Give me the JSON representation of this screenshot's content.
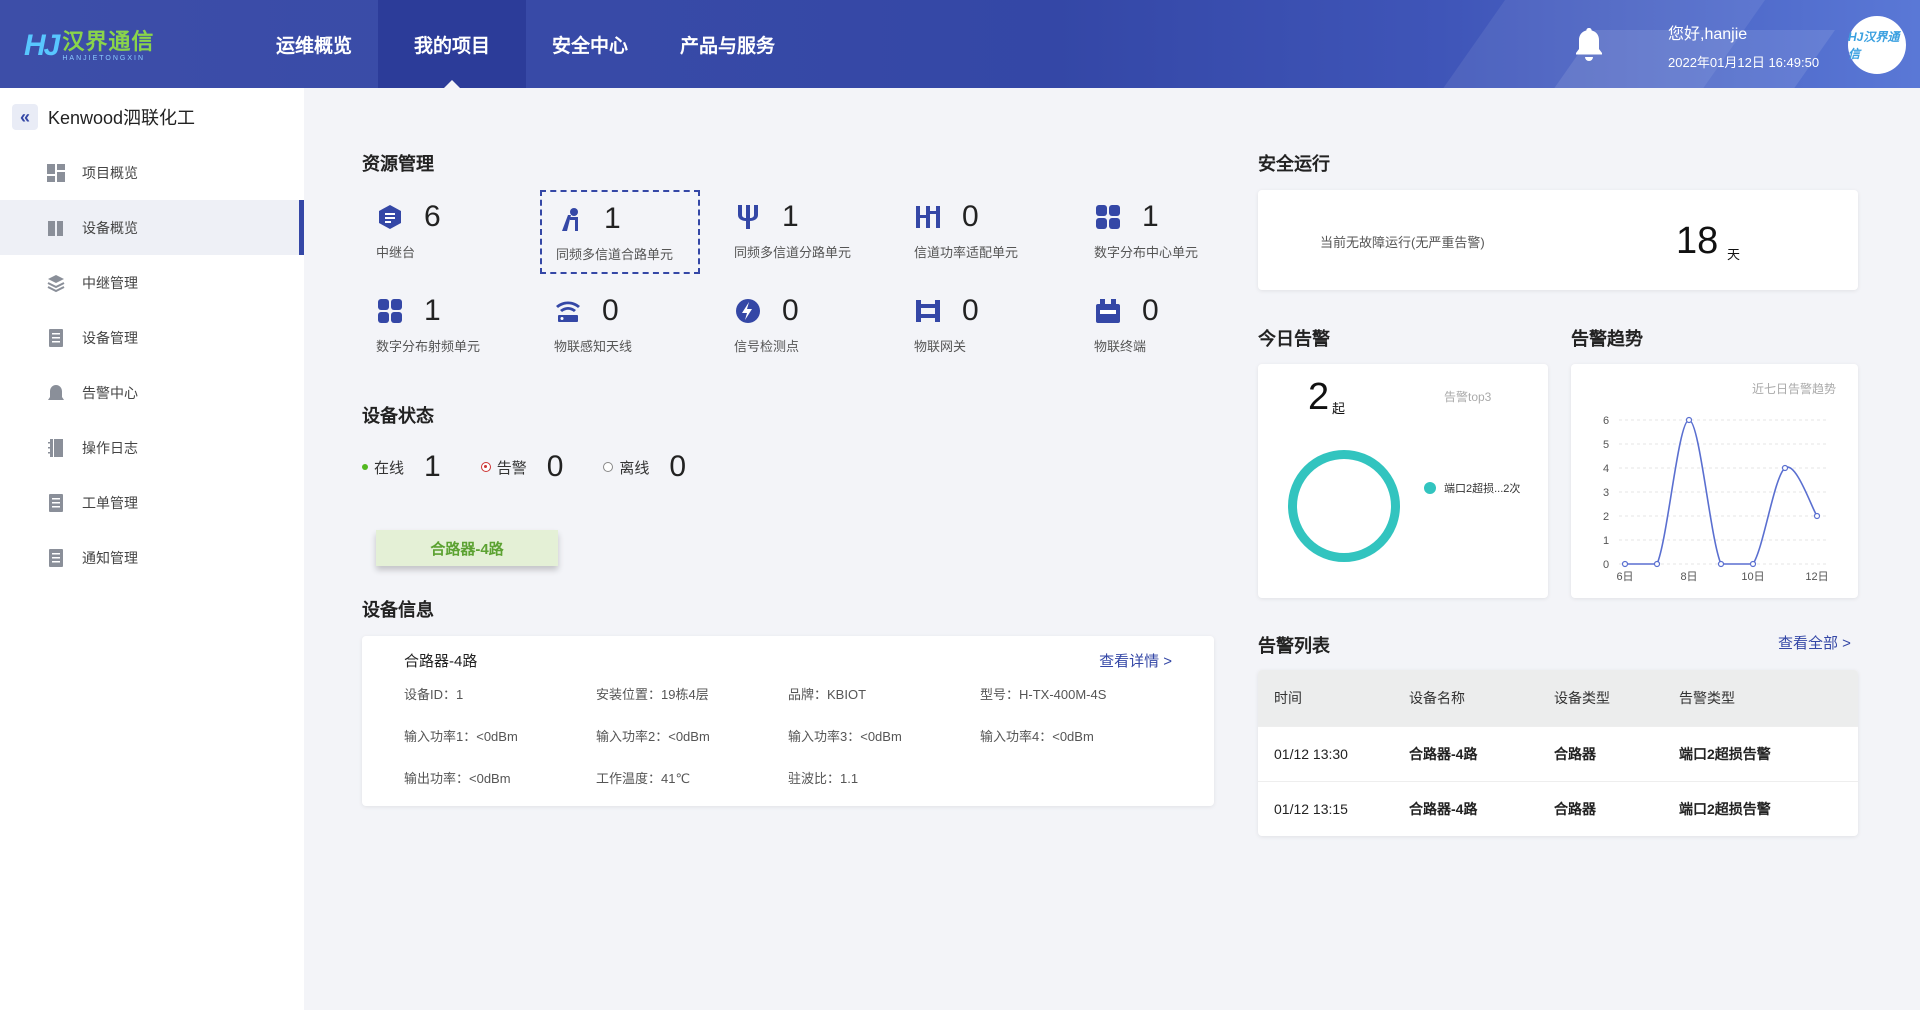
{
  "header": {
    "logo_mark": "HJ",
    "logo_text": "汉界通信",
    "logo_sub": "HANJIETONGXIN",
    "nav": [
      {
        "label": "运维概览"
      },
      {
        "label": "我的项目"
      },
      {
        "label": "安全中心"
      },
      {
        "label": "产品与服务"
      }
    ],
    "greeting": "您好,hanjie",
    "datetime": "2022年01月12日 16:49:50",
    "avatar_text": "HJ汉界通信"
  },
  "sidebar": {
    "back_icon": "«",
    "project": "Kenwood泗联化工",
    "items": [
      {
        "label": "项目概览",
        "icon": "dashboard-icon"
      },
      {
        "label": "设备概览",
        "icon": "book-icon"
      },
      {
        "label": "中继管理",
        "icon": "layers-icon"
      },
      {
        "label": "设备管理",
        "icon": "document-icon"
      },
      {
        "label": "告警中心",
        "icon": "bell-icon"
      },
      {
        "label": "操作日志",
        "icon": "notebook-icon"
      },
      {
        "label": "工单管理",
        "icon": "document-icon"
      },
      {
        "label": "通知管理",
        "icon": "document-icon"
      }
    ]
  },
  "resources": {
    "title": "资源管理",
    "items": [
      {
        "value": "6",
        "label": "中继台",
        "icon": "hexagon-icon"
      },
      {
        "value": "1",
        "label": "同频多信道合路单元",
        "icon": "combiner-icon"
      },
      {
        "value": "1",
        "label": "同频多信道分路单元",
        "icon": "splitter-icon"
      },
      {
        "value": "0",
        "label": "信道功率适配单元",
        "icon": "power-adapter-icon"
      },
      {
        "value": "1",
        "label": "数字分布中心单元",
        "icon": "grid-icon"
      },
      {
        "value": "1",
        "label": "数字分布射频单元",
        "icon": "grid-icon"
      },
      {
        "value": "0",
        "label": "物联感知天线",
        "icon": "wifi-icon"
      },
      {
        "value": "0",
        "label": "信号检测点",
        "icon": "bolt-icon"
      },
      {
        "value": "0",
        "label": "物联网关",
        "icon": "gateway-icon"
      },
      {
        "value": "0",
        "label": "物联终端",
        "icon": "terminal-icon"
      }
    ]
  },
  "device_status": {
    "title": "设备状态",
    "online_label": "在线",
    "online_value": "1",
    "alarm_label": "告警",
    "alarm_value": "0",
    "offline_label": "离线",
    "offline_value": "0",
    "colors": {
      "online": "#52b820",
      "alarm": "#cc3333",
      "offline": "#888888"
    }
  },
  "device_tag": "合路器-4路",
  "device_info": {
    "title": "设备信息",
    "name": "合路器-4路",
    "more": "查看详情 >",
    "fields": [
      "设备ID：1",
      "安装位置：19栋4层",
      "品牌：KBIOT",
      "型号：H-TX-400M-4S",
      "输入功率1：<0dBm",
      "输入功率2：<0dBm",
      "输入功率3：<0dBm",
      "输入功率4：<0dBm",
      "输出功率：<0dBm",
      "工作温度：41℃",
      "驻波比：1.1"
    ]
  },
  "safety": {
    "title": "安全运行",
    "label": "当前无故障运行(无严重告警)",
    "days": "18",
    "unit": "天"
  },
  "today_alarm": {
    "title": "今日告警",
    "count": "2",
    "unit": "起",
    "top3_label": "告警top3",
    "legend": "端口2超损...2次"
  },
  "trend": {
    "title": "告警趋势",
    "subtitle": "近七日告警趋势"
  },
  "chart_data": {
    "type": "line",
    "title": "近七日告警趋势",
    "x": [
      "6日",
      "7日",
      "8日",
      "9日",
      "10日",
      "11日",
      "12日"
    ],
    "x_tick_labels": [
      "6日",
      "8日",
      "10日",
      "12日"
    ],
    "series": [
      {
        "values": [
          0,
          0,
          6,
          0,
          0,
          4,
          2
        ]
      }
    ],
    "ylim": [
      0,
      6
    ],
    "y_ticks": [
      "0",
      "1",
      "2",
      "3",
      "4",
      "5",
      "6"
    ],
    "grid": true,
    "color": "#5a6fd0"
  },
  "alarm_list": {
    "title": "告警列表",
    "more": "查看全部 >",
    "headers": [
      "时间",
      "设备名称",
      "设备类型",
      "告警类型"
    ],
    "rows": [
      [
        "01/12 13:30",
        "合路器-4路",
        "合路器",
        "端口2超损告警"
      ],
      [
        "01/12 13:15",
        "合路器-4路",
        "合路器",
        "端口2超损告警"
      ]
    ]
  }
}
